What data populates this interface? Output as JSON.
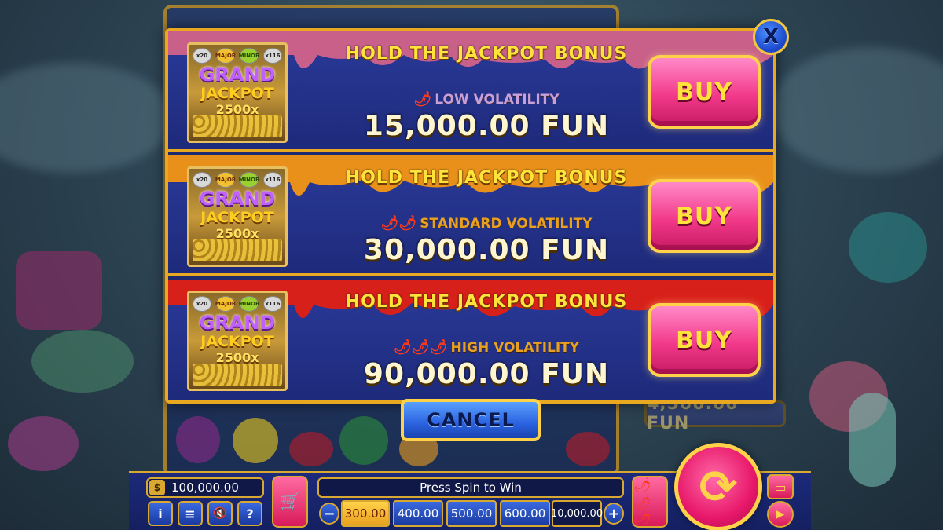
{
  "modal": {
    "close_label": "X",
    "offers": [
      {
        "title": "HOLD THE JACKPOT BONUS",
        "chilis": "🌶",
        "volatility": "LOW VOLATILITY",
        "price": "15,000.00 FUN",
        "buy_label": "BUY",
        "drip_color": "#c8608a"
      },
      {
        "title": "HOLD THE JACKPOT BONUS",
        "chilis": "🌶🌶",
        "volatility": "STANDARD VOLATILITY",
        "price": "30,000.00 FUN",
        "buy_label": "BUY",
        "drip_color": "#e8901a"
      },
      {
        "title": "HOLD THE JACKPOT BONUS",
        "chilis": "🌶🌶🌶",
        "volatility": "HIGH VOLATILITY",
        "price": "90,000.00 FUN",
        "buy_label": "BUY",
        "drip_color": "#d8201a"
      }
    ],
    "thumbnail": {
      "multipliers": [
        "x20",
        "MAJOR",
        "MINOR",
        "x116"
      ],
      "line1": "GRAND",
      "line2": "JACKPOT",
      "line3": "2500x"
    },
    "cancel_label": "CANCEL"
  },
  "background": {
    "side_win": "4,500.00 FUN"
  },
  "controls": {
    "balance": "100,000.00",
    "balance_icon": "money-bag-icon",
    "info_label": "i",
    "menu_label": "≡",
    "sound_label": "🔇",
    "help_label": "?",
    "status_text": "Press Spin to Win",
    "minus_label": "−",
    "plus_label": "+",
    "bets": [
      "300.00",
      "400.00",
      "500.00",
      "600.00",
      "10,000.00"
    ],
    "selected_bet_index": 0,
    "spin_label": "⟳"
  },
  "colors": {
    "frame_gold": "#e8a820",
    "panel_blue": "#1f2a6e",
    "buy_pink": "#f23a8a",
    "title_yellow": "#ffe23a"
  }
}
